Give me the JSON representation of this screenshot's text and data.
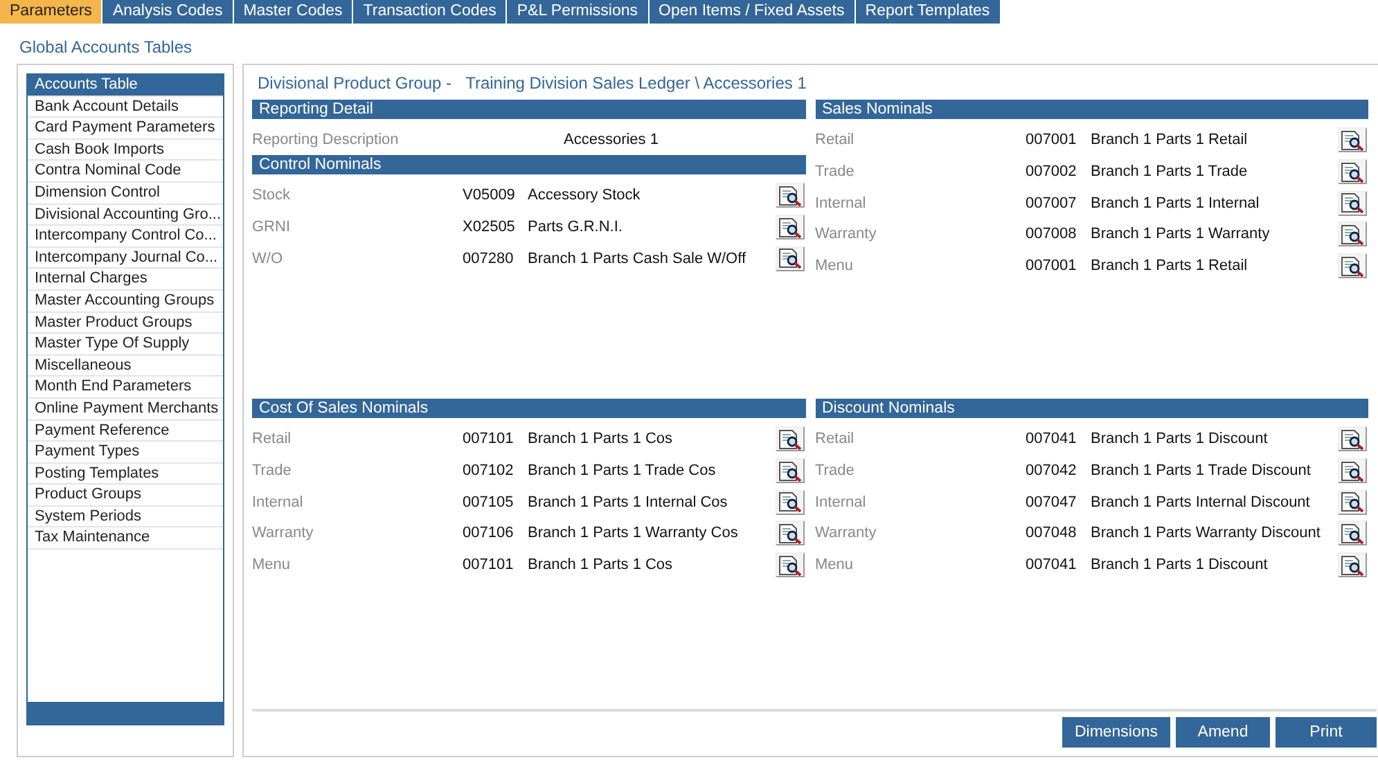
{
  "tabs": [
    {
      "label": "Parameters",
      "selected": true
    },
    {
      "label": "Analysis Codes",
      "selected": false
    },
    {
      "label": "Master Codes",
      "selected": false
    },
    {
      "label": "Transaction Codes",
      "selected": false
    },
    {
      "label": "P&L Permissions",
      "selected": false
    },
    {
      "label": "Open Items / Fixed Assets",
      "selected": false
    },
    {
      "label": "Report Templates",
      "selected": false
    }
  ],
  "page_title": "Global Accounts Tables",
  "sidebar": {
    "items": [
      {
        "label": "Accounts Table",
        "selected": true
      },
      {
        "label": "Bank Account Details",
        "selected": false
      },
      {
        "label": "Card Payment Parameters",
        "selected": false
      },
      {
        "label": "Cash Book Imports",
        "selected": false
      },
      {
        "label": "Contra Nominal Code",
        "selected": false
      },
      {
        "label": "Dimension Control",
        "selected": false
      },
      {
        "label": "Divisional Accounting Gro...",
        "selected": false
      },
      {
        "label": "Intercompany Control Co...",
        "selected": false
      },
      {
        "label": "Intercompany Journal Co...",
        "selected": false
      },
      {
        "label": "Internal Charges",
        "selected": false
      },
      {
        "label": "Master Accounting Groups",
        "selected": false
      },
      {
        "label": "Master Product Groups",
        "selected": false
      },
      {
        "label": "Master Type Of Supply",
        "selected": false
      },
      {
        "label": "Miscellaneous",
        "selected": false
      },
      {
        "label": "Month End Parameters",
        "selected": false
      },
      {
        "label": "Online Payment Merchants",
        "selected": false
      },
      {
        "label": "Payment Reference",
        "selected": false
      },
      {
        "label": "Payment Types",
        "selected": false
      },
      {
        "label": "Posting Templates",
        "selected": false
      },
      {
        "label": "Product Groups",
        "selected": false
      },
      {
        "label": "System Periods",
        "selected": false
      },
      {
        "label": "Tax Maintenance",
        "selected": false
      }
    ]
  },
  "detail": {
    "group_label": "Divisional Product Group -",
    "path": "Training Division Sales Ledger \\ Accessories 1",
    "top_left": [
      {
        "title": "Reporting Detail",
        "rows": [
          {
            "kind": "text",
            "label": "Reporting Description",
            "value": "Accessories 1"
          }
        ]
      },
      {
        "title": "Control Nominals",
        "rows": [
          {
            "kind": "nominal",
            "label": "Stock",
            "code": "V05009",
            "description": "Accessory Stock"
          },
          {
            "kind": "nominal",
            "label": "GRNI",
            "code": "X02505",
            "description": "Parts G.R.N.I."
          },
          {
            "kind": "nominal",
            "label": "W/O",
            "code": "007280",
            "description": "Branch 1 Parts Cash Sale W/Off"
          }
        ]
      }
    ],
    "top_right": [
      {
        "title": "Sales Nominals",
        "rows": [
          {
            "kind": "nominal",
            "label": "Retail",
            "code": "007001",
            "description": "Branch 1 Parts 1 Retail"
          },
          {
            "kind": "nominal",
            "label": "Trade",
            "code": "007002",
            "description": "Branch 1 Parts 1 Trade"
          },
          {
            "kind": "nominal",
            "label": "Internal",
            "code": "007007",
            "description": "Branch 1 Parts 1 Internal"
          },
          {
            "kind": "nominal",
            "label": "Warranty",
            "code": "007008",
            "description": "Branch 1 Parts 1 Warranty"
          },
          {
            "kind": "nominal",
            "label": "Menu",
            "code": "007001",
            "description": "Branch 1 Parts 1 Retail"
          }
        ]
      }
    ],
    "bottom_left": [
      {
        "title": "Cost Of Sales Nominals",
        "rows": [
          {
            "kind": "nominal",
            "label": "Retail",
            "code": "007101",
            "description": "Branch 1 Parts 1 Cos"
          },
          {
            "kind": "nominal",
            "label": "Trade",
            "code": "007102",
            "description": "Branch 1 Parts 1 Trade Cos"
          },
          {
            "kind": "nominal",
            "label": "Internal",
            "code": "007105",
            "description": "Branch 1 Parts 1 Internal Cos"
          },
          {
            "kind": "nominal",
            "label": "Warranty",
            "code": "007106",
            "description": "Branch 1 Parts 1 Warranty Cos"
          },
          {
            "kind": "nominal",
            "label": "Menu",
            "code": "007101",
            "description": "Branch 1 Parts 1 Cos"
          }
        ]
      }
    ],
    "bottom_right": [
      {
        "title": "Discount Nominals",
        "rows": [
          {
            "kind": "nominal",
            "label": "Retail",
            "code": "007041",
            "description": "Branch 1 Parts 1 Discount"
          },
          {
            "kind": "nominal",
            "label": "Trade",
            "code": "007042",
            "description": "Branch 1 Parts 1 Trade Discount"
          },
          {
            "kind": "nominal",
            "label": "Internal",
            "code": "007047",
            "description": "Branch 1 Parts Internal Discount"
          },
          {
            "kind": "nominal",
            "label": "Warranty",
            "code": "007048",
            "description": "Branch 1 Parts Warranty Discount"
          },
          {
            "kind": "nominal",
            "label": "Menu",
            "code": "007041",
            "description": "Branch 1 Parts 1 Discount"
          }
        ]
      }
    ]
  },
  "buttons": [
    "Dimensions",
    "Amend",
    "Print"
  ]
}
